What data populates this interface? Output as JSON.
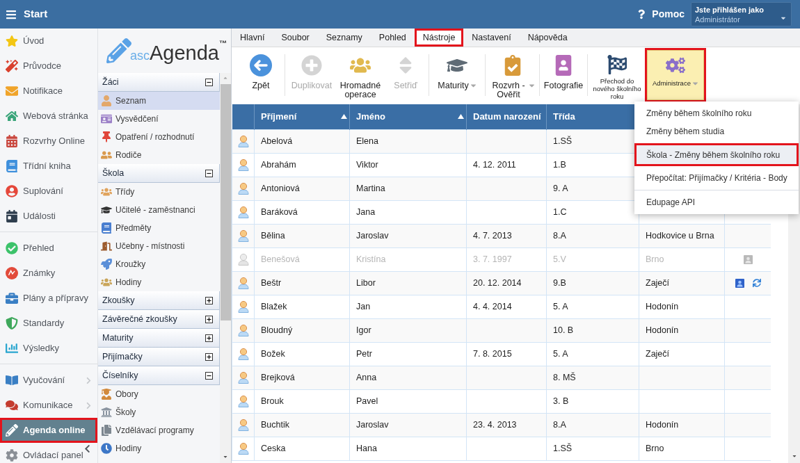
{
  "header": {
    "title": "Start",
    "help": "Pomoc",
    "account": {
      "caption": "Jste přihlášen jako",
      "name": "Administrátor"
    }
  },
  "nav": {
    "groups": [
      [
        {
          "label": "Úvod",
          "selected": false,
          "submenu": false,
          "highlighted": false
        },
        {
          "label": "Průvodce",
          "selected": false,
          "submenu": false,
          "highlighted": false
        },
        {
          "label": "Notifikace",
          "selected": false,
          "submenu": false,
          "highlighted": false
        },
        {
          "label": "Webová stránka",
          "selected": false,
          "submenu": false,
          "highlighted": false
        },
        {
          "label": "Rozvrhy Online",
          "selected": false,
          "submenu": false,
          "highlighted": false
        },
        {
          "label": "Třídní kniha",
          "selected": false,
          "submenu": false,
          "highlighted": false
        },
        {
          "label": "Suplování",
          "selected": false,
          "submenu": false,
          "highlighted": false
        },
        {
          "label": "Události",
          "selected": false,
          "submenu": false,
          "highlighted": false
        }
      ],
      [
        {
          "label": "Přehled",
          "selected": false,
          "submenu": false,
          "highlighted": false
        },
        {
          "label": "Známky",
          "selected": false,
          "submenu": false,
          "highlighted": false
        },
        {
          "label": "Plány a přípravy",
          "selected": false,
          "submenu": false,
          "highlighted": false
        },
        {
          "label": "Standardy",
          "selected": false,
          "submenu": false,
          "highlighted": false
        },
        {
          "label": "Výsledky",
          "selected": false,
          "submenu": false,
          "highlighted": false
        }
      ],
      [
        {
          "label": "Vyučování",
          "selected": false,
          "submenu": true,
          "highlighted": false
        },
        {
          "label": "Komunikace",
          "selected": false,
          "submenu": true,
          "highlighted": false
        },
        {
          "label": "Agenda online",
          "selected": true,
          "submenu": false,
          "highlighted": true
        },
        {
          "label": "Ovládací panel",
          "selected": false,
          "submenu": false,
          "highlighted": false
        }
      ]
    ]
  },
  "agenda": {
    "logo": {
      "prefix": "asc",
      "name": "Agenda",
      "mark": "™"
    },
    "sections": [
      {
        "title": "Žáci",
        "expanded": true,
        "items": [
          {
            "label": "Seznam",
            "selected": true
          },
          {
            "label": "Vysvědčení",
            "selected": false
          },
          {
            "label": "Opatření / rozhodnutí",
            "selected": false
          },
          {
            "label": "Rodiče",
            "selected": false
          }
        ]
      },
      {
        "title": "Škola",
        "expanded": true,
        "items": [
          {
            "label": "Třídy",
            "selected": false
          },
          {
            "label": "Učitelé - zaměstnanci",
            "selected": false
          },
          {
            "label": "Předměty",
            "selected": false
          },
          {
            "label": "Učebny - místnosti",
            "selected": false
          },
          {
            "label": "Kroužky",
            "selected": false
          },
          {
            "label": "Hodiny",
            "selected": false
          }
        ]
      },
      {
        "title": "Zkoušky",
        "expanded": false
      },
      {
        "title": "Závěrečné zkoušky",
        "expanded": false
      },
      {
        "title": "Maturity",
        "expanded": false
      },
      {
        "title": "Přijímačky",
        "expanded": false
      },
      {
        "title": "Číselníky",
        "expanded": true,
        "items": [
          {
            "label": "Obory",
            "selected": false
          },
          {
            "label": "Školy",
            "selected": false
          },
          {
            "label": "Vzdělávací programy",
            "selected": false
          },
          {
            "label": "Hodiny",
            "selected": false
          }
        ]
      }
    ]
  },
  "menu_tabs": [
    {
      "label": "Hlavní",
      "selected": false,
      "highlighted": false
    },
    {
      "label": "Soubor",
      "selected": false,
      "highlighted": false
    },
    {
      "label": "Seznamy",
      "selected": false,
      "highlighted": false
    },
    {
      "label": "Pohled",
      "selected": false,
      "highlighted": false
    },
    {
      "label": "Nástroje",
      "selected": true,
      "highlighted": true
    },
    {
      "label": "Nastavení",
      "selected": false,
      "highlighted": false
    },
    {
      "label": "Nápověda",
      "selected": false,
      "highlighted": false
    }
  ],
  "toolbar": {
    "groups": [
      [
        {
          "label": "Zpět",
          "kind": "normal",
          "disabled": false,
          "menu": false,
          "pressed": false,
          "highlighted": false
        }
      ],
      [
        {
          "label": "Duplikovat",
          "kind": "normal",
          "disabled": true,
          "menu": false,
          "pressed": false,
          "highlighted": false
        },
        {
          "label": "Hromadné operace",
          "kind": "normal",
          "disabled": false,
          "menu": false,
          "pressed": false,
          "highlighted": false
        },
        {
          "label": "Setřiď",
          "kind": "normal",
          "disabled": true,
          "menu": false,
          "pressed": false,
          "highlighted": false
        }
      ],
      [
        {
          "label": "Maturity",
          "kind": "normal",
          "disabled": false,
          "menu": true,
          "pressed": false,
          "highlighted": false
        }
      ],
      [
        {
          "label": "Rozvrh - Ověřit",
          "kind": "normal",
          "disabled": false,
          "menu": true,
          "pressed": false,
          "highlighted": false
        }
      ],
      [
        {
          "label": "Fotografie",
          "kind": "normal",
          "disabled": false,
          "menu": false,
          "pressed": false,
          "highlighted": false
        }
      ],
      [
        {
          "label": "Přechod do nového školního roku",
          "kind": "small",
          "disabled": false,
          "menu": false,
          "pressed": false,
          "highlighted": false
        },
        {
          "label": "Administrace",
          "kind": "small",
          "disabled": false,
          "menu": true,
          "pressed": true,
          "highlighted": true
        }
      ]
    ]
  },
  "table": {
    "columns": [
      {
        "label": "Příjmení",
        "sorted": true
      },
      {
        "label": "Jméno",
        "sorted": true
      },
      {
        "label": "Datum narození",
        "sorted": false
      },
      {
        "label": "Třída",
        "sorted": false
      }
    ],
    "rows": [
      {
        "surname": "Abelová",
        "first_name": "Elena",
        "class": "1.SŠ",
        "disabled": false,
        "photo": false,
        "sync": false
      },
      {
        "surname": "Abrahám",
        "first_name": "Viktor",
        "birth_date": "4. 12. 2011",
        "class": "1.B",
        "disabled": false,
        "photo": false,
        "sync": false
      },
      {
        "surname": "Antoniová",
        "first_name": "Martina",
        "class": "9. A",
        "disabled": false,
        "photo": false,
        "sync": false
      },
      {
        "surname": "Baráková",
        "first_name": "Jana",
        "class": "1.C",
        "disabled": false,
        "photo": false,
        "sync": false
      },
      {
        "surname": "Bělina",
        "first_name": "Jaroslav",
        "birth_date": "4. 7. 2013",
        "class": "8.A",
        "column_5": "Hodkovice u Brna",
        "disabled": false,
        "photo": false,
        "sync": false
      },
      {
        "surname": "Benešová",
        "first_name": "Kristína",
        "birth_date": "3. 7. 1997",
        "class": "5.V",
        "column_5": "Brno",
        "disabled": true,
        "photo": true,
        "sync": false
      },
      {
        "surname": "Beštr",
        "first_name": "Libor",
        "birth_date": "20. 12. 2014",
        "class": "9.B",
        "column_5": "Zaječí",
        "disabled": false,
        "photo": true,
        "sync": true
      },
      {
        "surname": "Blažek",
        "first_name": "Jan",
        "birth_date": "4. 4. 2014",
        "class": "5. A",
        "column_5": "Hodonín",
        "disabled": false,
        "photo": false,
        "sync": false
      },
      {
        "surname": "Bloudný",
        "first_name": "Igor",
        "class": "10. B",
        "column_5": "Hodonín",
        "disabled": false,
        "photo": false,
        "sync": false
      },
      {
        "surname": "Božek",
        "first_name": "Petr",
        "birth_date": "7. 8. 2015",
        "class": "5. A",
        "column_5": "Zaječí",
        "disabled": false,
        "photo": false,
        "sync": false
      },
      {
        "surname": "Brejková",
        "first_name": "Anna",
        "class": "8. MŠ",
        "disabled": false,
        "photo": false,
        "sync": false
      },
      {
        "surname": "Brouk",
        "first_name": "Pavel",
        "class": "3. B",
        "disabled": false,
        "photo": false,
        "sync": false
      },
      {
        "surname": "Buchtik",
        "first_name": "Jaroslav",
        "birth_date": "23. 4. 2013",
        "class": "8.A",
        "column_5": "Hodonín",
        "disabled": false,
        "photo": false,
        "sync": false
      },
      {
        "surname": "Ceska",
        "first_name": "Hana",
        "class": "1.SŠ",
        "column_5": "Brno",
        "disabled": false,
        "photo": false,
        "sync": false
      }
    ]
  },
  "dropdown": {
    "groups": [
      [
        {
          "label": "Změny během školního roku",
          "selected": false,
          "highlighted": false
        },
        {
          "label": "Změny během studia",
          "selected": false,
          "highlighted": false
        },
        {
          "label": "Škola - Změny během školního roku",
          "selected": true,
          "highlighted": true
        },
        {
          "label": "Přepočítat: Přijímačky / Kritéria - Body",
          "selected": false,
          "highlighted": false
        }
      ],
      [
        {
          "label": "Edupage API",
          "selected": false,
          "highlighted": false
        }
      ]
    ]
  }
}
